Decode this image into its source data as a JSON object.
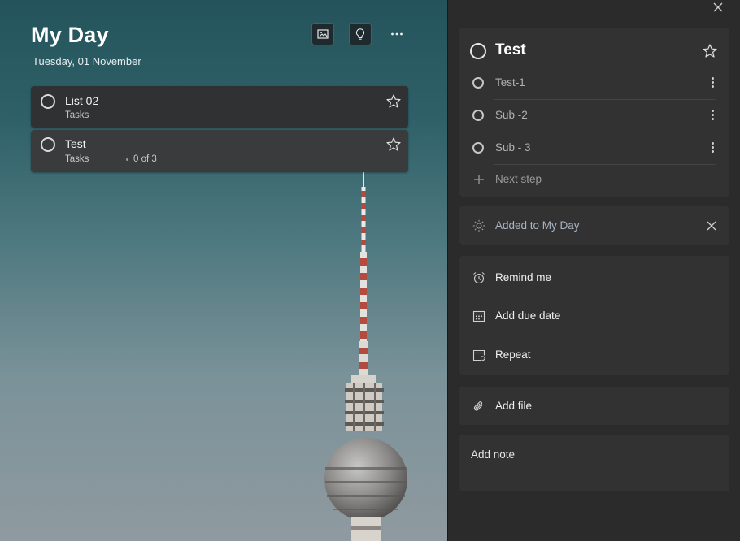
{
  "myday": {
    "title": "My Day",
    "date": "Tuesday, 01 November",
    "tasks": [
      {
        "name": "List 02",
        "list": "Tasks",
        "steps": ""
      },
      {
        "name": "Test",
        "list": "Tasks",
        "steps": "0 of 3"
      }
    ]
  },
  "detail": {
    "title": "Test",
    "steps": [
      {
        "label": "Test-1"
      },
      {
        "label": "Sub -2"
      },
      {
        "label": "Sub - 3"
      }
    ],
    "next_step_label": "Next step",
    "added_to_myday": "Added to My Day",
    "remind_me": "Remind me",
    "add_due_date": "Add due date",
    "repeat": "Repeat",
    "add_file": "Add file",
    "add_note": "Add note"
  },
  "colors": {
    "panel_bg": "#2b2b2b",
    "card_bg": "#323232",
    "task_bg": "#2f3133",
    "muted_text": "#b0b0b0"
  }
}
